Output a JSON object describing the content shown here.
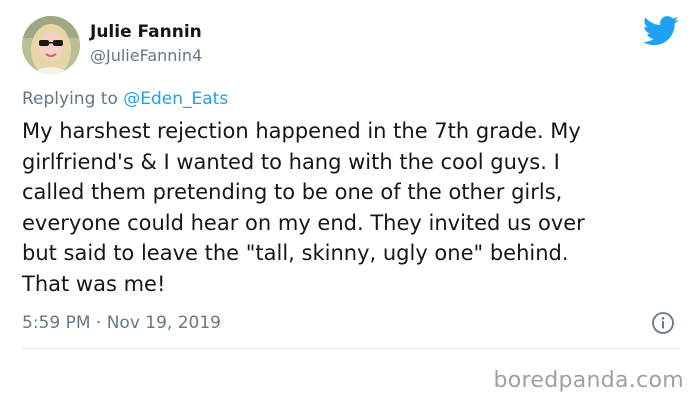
{
  "author": {
    "name": "Julie Fannin",
    "handle": "@JulieFannin4"
  },
  "reply": {
    "prefix": "Replying to ",
    "mention": "@Eden_Eats"
  },
  "tweet": {
    "lines": [
      "My harshest rejection happened in the 7th grade. My",
      "girlfriend's & I wanted to hang with the cool guys. I",
      "called them pretending to be one of the other girls,",
      "everyone could hear on my end. They invited us over",
      "but said to leave the \"tall, skinny, ugly one\" behind.",
      "That was me!"
    ]
  },
  "meta": {
    "timestamp": "5:59 PM · Nov 19, 2019"
  },
  "icons": {
    "brand": "twitter-bird-icon",
    "info": "info-icon"
  },
  "watermark": "boredpanda.com",
  "colors": {
    "brand_blue": "#1da1f2",
    "text": "#14171a",
    "secondary": "#657786",
    "divider": "#e1e8ed",
    "watermark": "#9ea0a2"
  }
}
